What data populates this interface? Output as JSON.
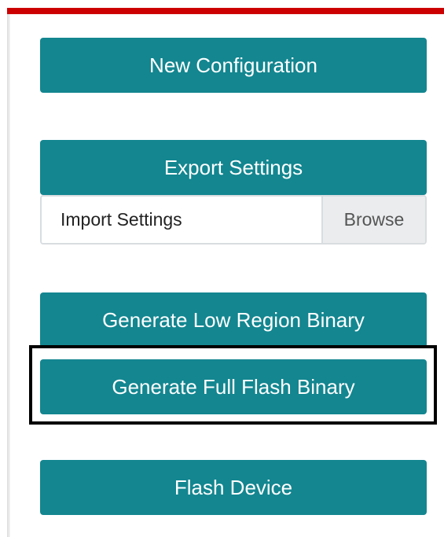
{
  "buttons": {
    "new_configuration": "New Configuration",
    "export_settings": "Export Settings",
    "generate_low_region_binary": "Generate Low Region Binary",
    "generate_full_flash_binary": "Generate Full Flash Binary",
    "flash_device": "Flash Device"
  },
  "import": {
    "label": "Import Settings",
    "browse_label": "Browse"
  },
  "colors": {
    "accent": "#138690",
    "top_bar": "#cc0000",
    "highlight_border": "#000000"
  }
}
